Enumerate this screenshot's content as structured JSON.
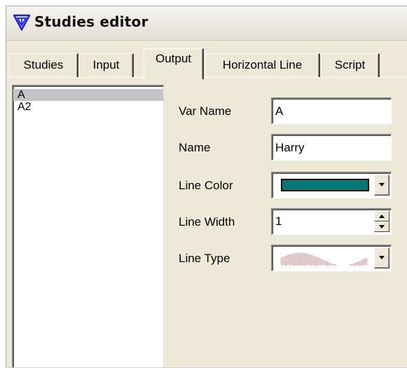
{
  "window": {
    "title": "Studies editor",
    "icon": "triangle-logo-icon",
    "accent_color": "#1a1aff"
  },
  "tabs": [
    {
      "label": "Studies",
      "active": false
    },
    {
      "label": "Input",
      "active": false
    },
    {
      "label": "Output",
      "active": true
    },
    {
      "label": "Horizontal Line",
      "active": false
    },
    {
      "label": "Script",
      "active": false
    }
  ],
  "outputs_list": {
    "items": [
      {
        "label": "A",
        "selected": true
      },
      {
        "label": "A2",
        "selected": false
      }
    ]
  },
  "form": {
    "var_name_label": "Var Name",
    "var_name_value": "A",
    "name_label": "Name",
    "name_value": "Harry",
    "line_color_label": "Line Color",
    "line_color_value": "#007a75",
    "line_width_label": "Line Width",
    "line_width_value": "1",
    "line_type_label": "Line Type",
    "line_type_preview_color": "#e03030"
  }
}
